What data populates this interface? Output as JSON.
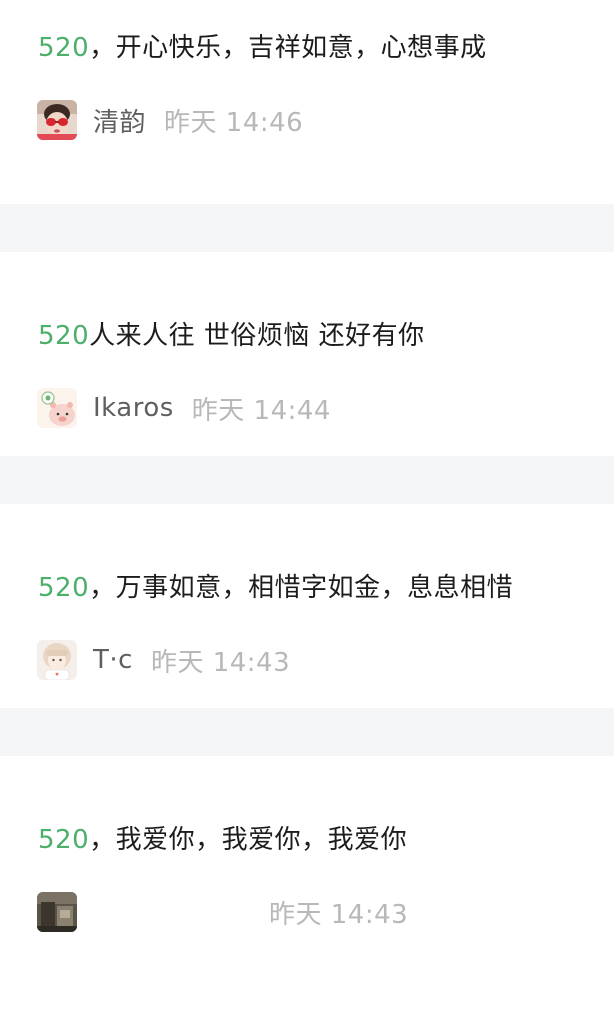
{
  "comments": [
    {
      "tag": "520",
      "text": "，开心快乐，吉祥如意，心想事成",
      "username": "清韵",
      "time": "昨天 14:46",
      "avatar_icon": "girl-red-sunglasses-avatar"
    },
    {
      "tag": "520",
      "text": "人来人往 世俗烦恼 还好有你",
      "username": "Ikaros",
      "time": "昨天 14:44",
      "avatar_icon": "pig-cartoon-avatar"
    },
    {
      "tag": "520",
      "text": "，万事如意，相惜字如金，息息相惜",
      "username": "T·c",
      "time": "昨天 14:43",
      "avatar_icon": "anime-girl-avatar"
    },
    {
      "tag": "520",
      "text": "，我爱你，我爱你，我爱你",
      "username": "",
      "time": "昨天 14:43",
      "avatar_icon": "dark-photo-avatar"
    }
  ],
  "colors": {
    "tag_green": "#4caf6a",
    "separator": "#f4f5f7",
    "text": "#1c1c1c",
    "username": "#5f5f5f",
    "time": "#b8b8b8"
  }
}
